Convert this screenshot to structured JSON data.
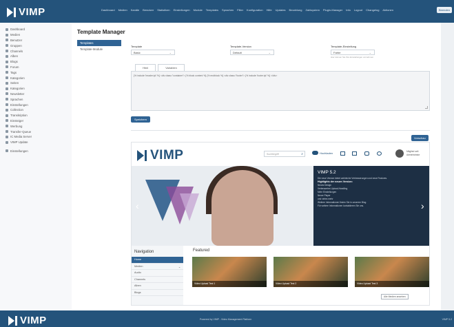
{
  "app": {
    "logo_text": "VIMP",
    "nav": [
      "Dashboard",
      "Medien",
      "Kanäle",
      "Benutzer",
      "Statistiken",
      "Einstellungen",
      "Module",
      "Templates",
      "Sprachen",
      "Filter",
      "Konfiguration",
      "Hilfe",
      "Updates",
      "Bezahlung",
      "Zahlsystem",
      "Plugin-Manager",
      "Info",
      "Logout",
      "Changelog",
      "Aktionen"
    ],
    "top_button": "Beenden"
  },
  "sidebar": {
    "items": [
      "Dashboard",
      "Medien",
      "Benutzer",
      "Gruppen",
      "Channels",
      "Alben",
      "Blogs",
      "Forum",
      "Tags",
      "Kategorien",
      "Seiten",
      "Kategorien",
      "Newsletter",
      "Sprachen",
      "Einstellungen",
      "Collection",
      "Transkription",
      "Einsteiger",
      "Werbung",
      "Transfer-Queue",
      "IC Media Server",
      "VIMP Update",
      "Einstellungen"
    ]
  },
  "page": {
    "title": "Template Manager",
    "list": [
      "Templates",
      "Template-Module"
    ],
    "fields": [
      {
        "label": "Template",
        "value": "Basic",
        "hint": ""
      },
      {
        "label": "Template-Version",
        "value": "Default",
        "hint": ""
      },
      {
        "label": "Template-Einstellung",
        "value": "Farbe",
        "hint": "Hier können Sie Ihre Einstellungen vornehmen"
      }
    ],
    "tabs": [
      "Html",
      "Variablen"
    ],
    "editor_text": "{% include 'header.tpl' %} <div class=\"container\"> {% block content %} {% endblock %} <div class=\"footer\"> {% include 'footer.tpl' %} </div>",
    "save_label": "Speichern",
    "preview_label": "Vorschau"
  },
  "preview": {
    "logo_text": "VIMP",
    "search_placeholder": "Suchbegriff",
    "upload_label": "Hochladen",
    "user_line1": "Mitglied seit",
    "user_line2": "Administrator",
    "hero": {
      "heading": "VIMP 5.2",
      "intro": "Die neue Version bietet zahlreiche Verbesserungen und neue Features.",
      "bold": "Highlights der neuen Version:",
      "bullets": [
        "Neues Design",
        "Verbessertes Upload-Handling",
        "Mehr Einstellungen",
        "Neuer Player",
        "und vieles mehr"
      ],
      "note1": "Weitere Informationen finden Sie in unserem Blog.",
      "note2": "Für weitere Informationen kontaktieren Sie uns."
    },
    "nav_title": "Navigation",
    "nav_items": [
      "Home",
      "Medien",
      "Audio",
      "Channels",
      "Alben",
      "Blogs"
    ],
    "featured_title": "Featured",
    "featured": [
      "Video Upload Test 1",
      "Video Upload Test 2",
      "Video Upload Test 3"
    ],
    "more_label": "Alle Medien ansehen"
  },
  "footer": {
    "logo_text": "VIMP",
    "text": "Powered by VIMP - Video Management Platform",
    "right": "VIMP 5.2"
  }
}
